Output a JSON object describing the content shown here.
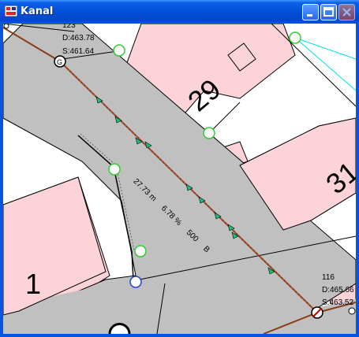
{
  "window": {
    "title": "Kanal"
  },
  "parcels": {
    "p29": "29",
    "p31": "31",
    "p1": "1"
  },
  "node_top": {
    "id": "123",
    "d": "D:463.78",
    "s": "S:461.64"
  },
  "node_bottom": {
    "id": "116",
    "d": "D:465.66",
    "s": "S:463.52"
  },
  "pipe": {
    "length": "27.73 m",
    "slope": "6.78 %",
    "diameter": "500",
    "material": "B"
  },
  "colors": {
    "building": "#fcd3d8",
    "road": "#c0c0c0",
    "pipe": "#8b3a1a",
    "node_green": "#33cc33",
    "node_blue": "#2244cc",
    "cyan_line": "#00e0e0"
  }
}
